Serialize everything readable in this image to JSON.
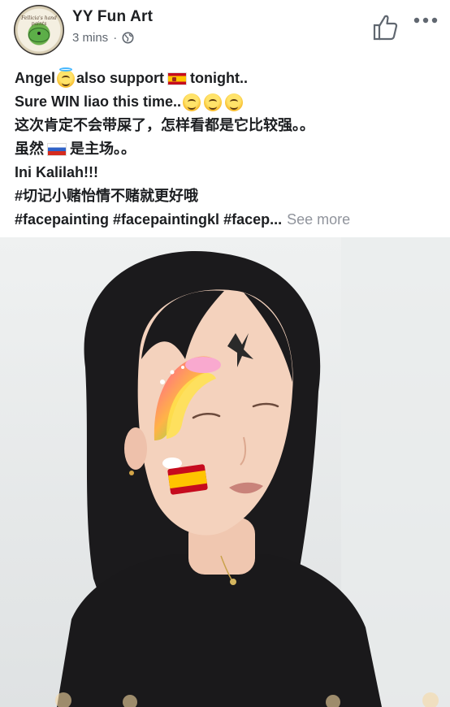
{
  "post": {
    "author_name": "YY Fun Art",
    "timestamp": "3 mins",
    "meta_separator": "·",
    "avatar_text": "Fellicia's hand paints",
    "privacy_icon": "globe-icon",
    "like_icon": "thumbs-up-icon",
    "more_icon": "more-dots-icon"
  },
  "text": {
    "line1_a": "Angel",
    "line1_b": "also support",
    "line1_c": "tonight..",
    "line2": "Sure WIN liao this time..",
    "line3": "这次肯定不会带屎了，怎样看都是它比较强。。",
    "line4_a": "虽然",
    "line4_b": "是主场。。",
    "line5": "Ini Kalilah!!!",
    "line6": "#切记小赌怡情不赌就更好哦",
    "line7": "#facepainting #facepaintingkl #facep...",
    "see_more": "See more"
  },
  "colors": {
    "primary_text": "#1c1e21",
    "secondary_text": "#606770",
    "see_more": "#90949c",
    "photo_background": "#e3e6e7"
  },
  "photo": {
    "alt": "Woman with rainbow face painting and Spanish flag on her cheek"
  }
}
